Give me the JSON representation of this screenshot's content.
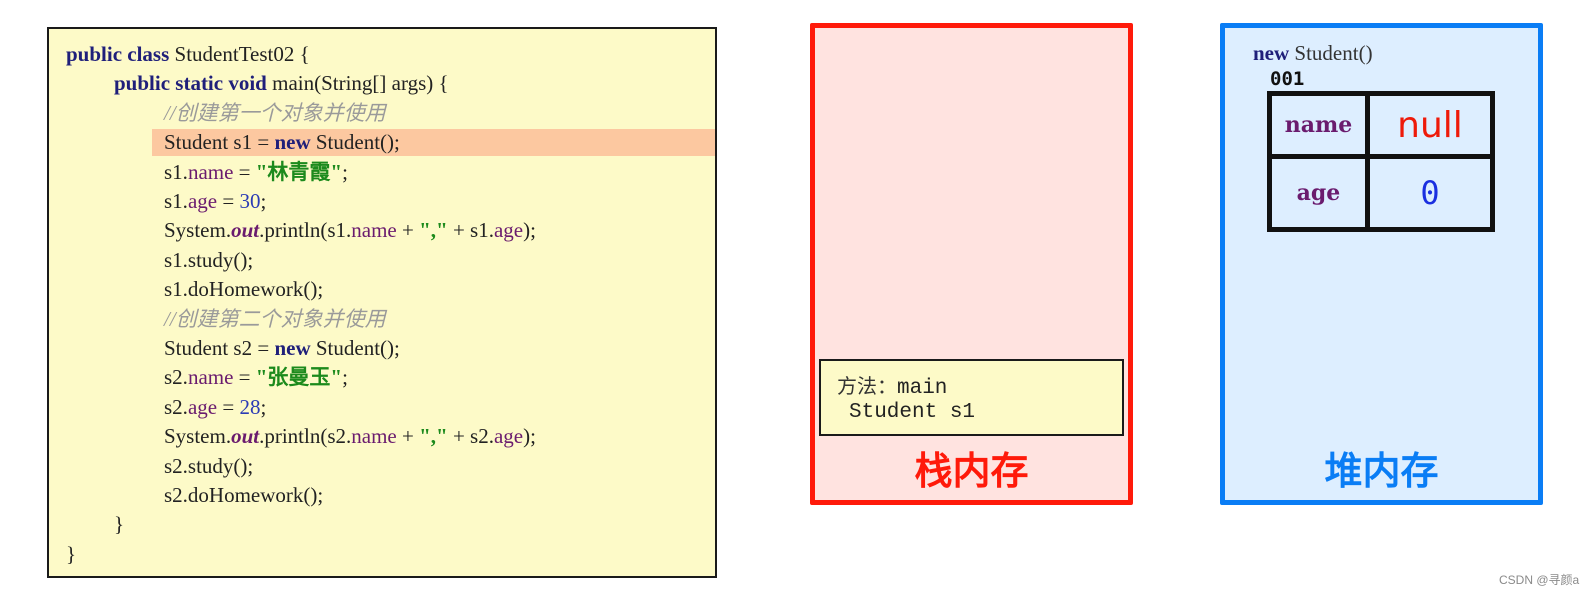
{
  "code": {
    "lines": [
      {
        "indent": 0,
        "tokens": [
          {
            "t": "public class ",
            "c": "kw"
          },
          {
            "t": "StudentTest02 {",
            "c": ""
          }
        ]
      },
      {
        "indent": 1,
        "tokens": [
          {
            "t": "public static void ",
            "c": "kw"
          },
          {
            "t": "main(String[] args) {",
            "c": ""
          }
        ]
      },
      {
        "indent": 2,
        "tokens": [
          {
            "t": "//创建第一个对象并使用",
            "c": "cmt"
          }
        ]
      },
      {
        "indent": 2,
        "highlight": true,
        "tokens": [
          {
            "t": "Student s1 = ",
            "c": ""
          },
          {
            "t": "new ",
            "c": "kw"
          },
          {
            "t": "Student();",
            "c": ""
          }
        ]
      },
      {
        "indent": 2,
        "tokens": [
          {
            "t": "s1.",
            "c": ""
          },
          {
            "t": "name",
            "c": "field"
          },
          {
            "t": " = ",
            "c": ""
          },
          {
            "t": "\"林青霞\"",
            "c": "str"
          },
          {
            "t": ";",
            "c": ""
          }
        ]
      },
      {
        "indent": 2,
        "tokens": [
          {
            "t": "s1.",
            "c": ""
          },
          {
            "t": "age",
            "c": "field"
          },
          {
            "t": " = ",
            "c": ""
          },
          {
            "t": "30",
            "c": "num"
          },
          {
            "t": ";",
            "c": ""
          }
        ]
      },
      {
        "indent": 2,
        "tokens": [
          {
            "t": "System.",
            "c": ""
          },
          {
            "t": "out",
            "c": "static-field"
          },
          {
            "t": ".println(s1.",
            "c": ""
          },
          {
            "t": "name",
            "c": "field"
          },
          {
            "t": " + ",
            "c": ""
          },
          {
            "t": "\",\"",
            "c": "str"
          },
          {
            "t": " + s1.",
            "c": ""
          },
          {
            "t": "age",
            "c": "field"
          },
          {
            "t": ");",
            "c": ""
          }
        ]
      },
      {
        "indent": 2,
        "tokens": [
          {
            "t": "s1.study();",
            "c": ""
          }
        ]
      },
      {
        "indent": 2,
        "tokens": [
          {
            "t": "s1.doHomework();",
            "c": ""
          }
        ]
      },
      {
        "indent": 2,
        "tokens": [
          {
            "t": "//创建第二个对象并使用",
            "c": "cmt"
          }
        ]
      },
      {
        "indent": 2,
        "tokens": [
          {
            "t": "Student s2 = ",
            "c": ""
          },
          {
            "t": "new ",
            "c": "kw"
          },
          {
            "t": "Student();",
            "c": ""
          }
        ]
      },
      {
        "indent": 2,
        "tokens": [
          {
            "t": "s2.",
            "c": ""
          },
          {
            "t": "name",
            "c": "field"
          },
          {
            "t": " = ",
            "c": ""
          },
          {
            "t": "\"张曼玉\"",
            "c": "str"
          },
          {
            "t": ";",
            "c": ""
          }
        ]
      },
      {
        "indent": 2,
        "tokens": [
          {
            "t": "s2.",
            "c": ""
          },
          {
            "t": "age",
            "c": "field"
          },
          {
            "t": " = ",
            "c": ""
          },
          {
            "t": "28",
            "c": "num"
          },
          {
            "t": ";",
            "c": ""
          }
        ]
      },
      {
        "indent": 2,
        "tokens": [
          {
            "t": "System.",
            "c": ""
          },
          {
            "t": "out",
            "c": "static-field"
          },
          {
            "t": ".println(s2.",
            "c": ""
          },
          {
            "t": "name",
            "c": "field"
          },
          {
            "t": " + ",
            "c": ""
          },
          {
            "t": "\",\"",
            "c": "str"
          },
          {
            "t": " + s2.",
            "c": ""
          },
          {
            "t": "age",
            "c": "field"
          },
          {
            "t": ");",
            "c": ""
          }
        ]
      },
      {
        "indent": 2,
        "tokens": [
          {
            "t": "s2.study();",
            "c": ""
          }
        ]
      },
      {
        "indent": 2,
        "tokens": [
          {
            "t": "s2.doHomework();",
            "c": ""
          }
        ]
      },
      {
        "indent": 1,
        "tokens": [
          {
            "t": "}",
            "c": ""
          }
        ]
      },
      {
        "indent": 0,
        "tokens": [
          {
            "t": "}",
            "c": ""
          }
        ]
      }
    ]
  },
  "stack": {
    "title": "栈内存",
    "frame": {
      "method_label": "方法：",
      "method_name": "main",
      "variable": "Student s1"
    },
    "colors": {
      "border": "#ff1a0a",
      "fill": "#ffe3e0"
    }
  },
  "heap": {
    "title": "堆内存",
    "expr_keyword": "new",
    "expr_rest": " Student()",
    "address": "001",
    "fields": [
      {
        "name": "name",
        "value": "null"
      },
      {
        "name": "age",
        "value": "0"
      }
    ],
    "colors": {
      "border": "#0a7df5",
      "fill": "#ddeeff"
    }
  },
  "watermark": "CSDN @寻颜a"
}
